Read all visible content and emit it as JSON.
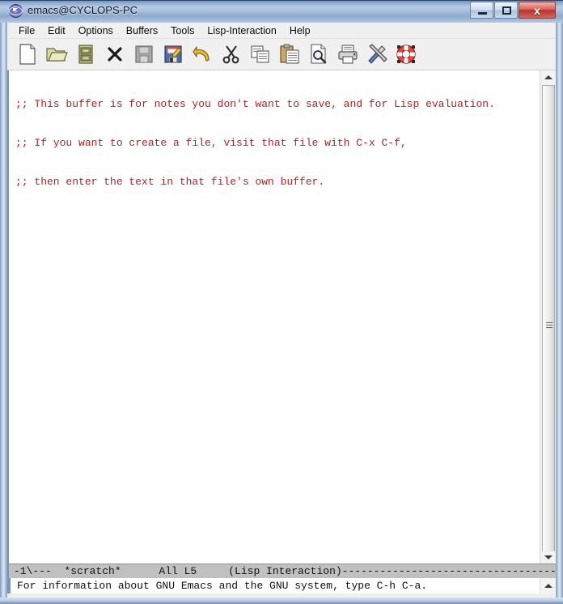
{
  "window": {
    "title": "emacs@CYCLOPS-PC",
    "icon": "emacs-icon",
    "controls": {
      "minimize": "–",
      "maximize": "□",
      "close": "x"
    }
  },
  "menubar": {
    "items": [
      {
        "label": "File",
        "name": "menu-file"
      },
      {
        "label": "Edit",
        "name": "menu-edit"
      },
      {
        "label": "Options",
        "name": "menu-options"
      },
      {
        "label": "Buffers",
        "name": "menu-buffers"
      },
      {
        "label": "Tools",
        "name": "menu-tools"
      },
      {
        "label": "Lisp-Interaction",
        "name": "menu-lisp-interaction"
      },
      {
        "label": "Help",
        "name": "menu-help"
      }
    ]
  },
  "toolbar": {
    "buttons": [
      {
        "icon": "new-file-icon",
        "label": "New File"
      },
      {
        "icon": "open-folder-icon",
        "label": "Open File"
      },
      {
        "icon": "file-cabinet-icon",
        "label": "Open Directory"
      },
      {
        "icon": "close-buffer-icon",
        "label": "Close Buffer"
      },
      {
        "icon": "save-icon",
        "label": "Save Buffer"
      },
      {
        "icon": "save-as-icon",
        "label": "Save As"
      },
      {
        "icon": "undo-icon",
        "label": "Undo"
      },
      {
        "icon": "cut-scissors-icon",
        "label": "Cut"
      },
      {
        "icon": "copy-icon",
        "label": "Copy"
      },
      {
        "icon": "paste-clipboard-icon",
        "label": "Paste"
      },
      {
        "icon": "search-icon",
        "label": "Search"
      },
      {
        "icon": "print-icon",
        "label": "Print Buffer"
      },
      {
        "icon": "customize-tools-icon",
        "label": "Customize"
      },
      {
        "icon": "help-lifesaver-icon",
        "label": "Help"
      }
    ]
  },
  "buffer": {
    "name": "*scratch*",
    "lines": [
      ";; This buffer is for notes you don't want to save, and for Lisp evaluation.",
      ";; If you want to create a file, visit that file with C-x C-f,",
      ";; then enter the text in that file's own buffer."
    ],
    "text_color": "#b22222"
  },
  "modeline": {
    "text": "-1\\---  *scratch*      All L5     (Lisp Interaction)------------------------------------------------------",
    "coding": "-1\\---",
    "buffer_name": "*scratch*",
    "position": "All",
    "line": "L5",
    "major_mode": "(Lisp Interaction)"
  },
  "echo_area": {
    "message": "For information about GNU Emacs and the GNU system, type C-h C-a."
  },
  "scrollbar": {
    "up_arrow": "scroll-up-arrow-icon",
    "down_arrow": "scroll-down-arrow-icon",
    "thumb": "scroll-thumb"
  },
  "colors": {
    "titlebar": "#a6bcd8",
    "frame": "#7e9cc4",
    "toolbar_bg": "#f0f0f0",
    "buffer_bg": "#ffffff",
    "modeline_bg": "#c0c0c0",
    "comment_red": "#b22222",
    "close_button": "#b8332c"
  }
}
